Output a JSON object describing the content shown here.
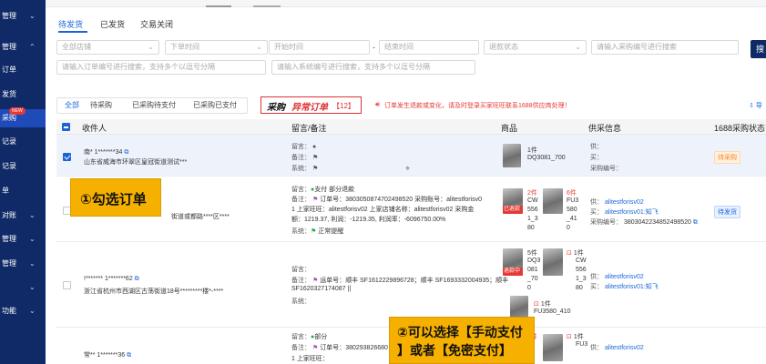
{
  "sidebar": {
    "items": [
      {
        "label": "管理",
        "chevron": "⌄",
        "active": false
      },
      {
        "label": "管理",
        "chevron": "⌃",
        "active": false
      },
      {
        "label": "订单",
        "chevron": "",
        "active": false
      },
      {
        "label": "发货",
        "chevron": "",
        "active": false
      },
      {
        "label": "采购",
        "chevron": "",
        "active": true
      },
      {
        "label": "记录",
        "chevron": "",
        "active": false
      },
      {
        "label": "记录",
        "chevron": "",
        "active": false
      },
      {
        "label": "单",
        "chevron": "",
        "active": false
      },
      {
        "label": "对账",
        "chevron": "⌄",
        "active": false
      },
      {
        "label": "管理",
        "chevron": "⌄",
        "active": false
      },
      {
        "label": "管理",
        "chevron": "⌄",
        "active": false
      },
      {
        "label": "",
        "chevron": "⌄",
        "active": false
      },
      {
        "label": "功能",
        "chevron": "⌄",
        "active": false
      }
    ],
    "new_badge": "NEW"
  },
  "status_tabs": [
    "待发货",
    "已发货",
    "交易关闭"
  ],
  "filters": {
    "shop": "全部店铺",
    "order_time": "下单时间",
    "start_time": "开始时间",
    "dash": "-",
    "end_time": "结束时间",
    "refund_status": "退款状态",
    "purchase_no": "请输入采购编号进行搜索",
    "order_no": "请输入订单编号进行搜索，支持多个以逗号分隔",
    "system_no": "请输入系统编号进行搜索，支持多个以逗号分隔",
    "search_btn": "搜"
  },
  "seg_tabs": [
    "全部",
    "待采购",
    "已采购待支付",
    "已采购已支付"
  ],
  "abnormal": {
    "title_a": "采购",
    "title_b": "异常订单",
    "count": "【12】"
  },
  "warning": "订单发生退款或变化，请及时登录买家旺旺联系1688供应商处理！",
  "export_link": "导",
  "table": {
    "headers": [
      "收件人",
      "留言/备注",
      "商品",
      "供采信息",
      "1688采购状态"
    ]
  },
  "rows": [
    {
      "recipient_name": "南* 1*******34",
      "recipient_addr": "山东省威海市环翠区皇冠街道测试***",
      "msg_label": "留言：",
      "note_label": "备注：",
      "sys_label": "系统：",
      "items": [
        {
          "qty": "1件",
          "code": "DQ3081_700"
        }
      ],
      "supply": {
        "supplier": "供：",
        "buyer": "买：",
        "po_label": "采购编号："
      },
      "status": "待采购"
    },
    {
      "recipient_addr": "街道或都路****区****",
      "pay_status": "支付 部分退款",
      "note_line1": "备注：",
      "note_pre": "订单号：",
      "note_body1": "3803050874702498520 采购账号：alitestforisv0",
      "note_body2": "1 上家旺旺：alitestforisv02 上家店铺名称：alitestforisv02 采购金",
      "note_body3": "额：1219.37, 利润：-1219.35, 利润率：-6096750.00%",
      "sys_label": "系统：",
      "sys_status": "正常提醒",
      "items": [
        {
          "qty": "2件",
          "code1": "CW",
          "code2": "556",
          "code3": "1_3",
          "code4": "80",
          "badge": "已退款"
        },
        {
          "qty": "6件",
          "code1": "FU3",
          "code2": "580",
          "code3": "_41",
          "code4": "0"
        }
      ],
      "supply": {
        "supplier_label": "供：",
        "supplier": "alitestforisv02",
        "buyer_label": "买：",
        "buyer": "alitestforisv01:知飞",
        "po_label": "采购编号：",
        "po": "3803042234852498520"
      },
      "status": "待发货"
    },
    {
      "recipient_name": "!******* 1*******62",
      "recipient_addr": "浙江省杭州市西湖区古荡街道18号*********楼*-****",
      "msg_label": "留言：",
      "note_label": "备注：",
      "note_body1": "运单号：",
      "note_body1b": "顺丰 SF1612229896728；顺丰 SF1693332004935；顺丰",
      "note_body2": "SF1620327174087 ||",
      "sys_label": "系统：",
      "items": [
        {
          "qty": "5件",
          "code1": "DQ3",
          "code2": "081",
          "code3": "_70",
          "code4": "0",
          "badge": "退款中"
        },
        {
          "qty": "1件",
          "code1": "CW",
          "code2": "556",
          "code3": "1_3",
          "code4": "80"
        },
        {
          "qty": "1件",
          "code1": "FU3580_410"
        }
      ],
      "supply": {
        "supplier_label": "供：",
        "supplier": "alitestforisv02",
        "buyer_label": "买：",
        "buyer": "alitestforisv01:知飞"
      }
    },
    {
      "recipient_name": "常** 1*******36",
      "pay_status": "部分",
      "note_label": "备注：",
      "note_pre": "订单号：",
      "note_body1": "380293826680",
      "note_body2": "1 上家旺旺：",
      "items": [
        {
          "qty": "5件",
          "code1": ""
        },
        {
          "qty": "1件",
          "code1": "FU3"
        }
      ],
      "supply": {
        "supplier_label": "供：",
        "supplier": "alitestforisv02"
      }
    }
  ],
  "callouts": {
    "one": "①勾选订单",
    "two_a": "②可以选择【手动支付",
    "two_b": "】或者【免密支付】"
  }
}
